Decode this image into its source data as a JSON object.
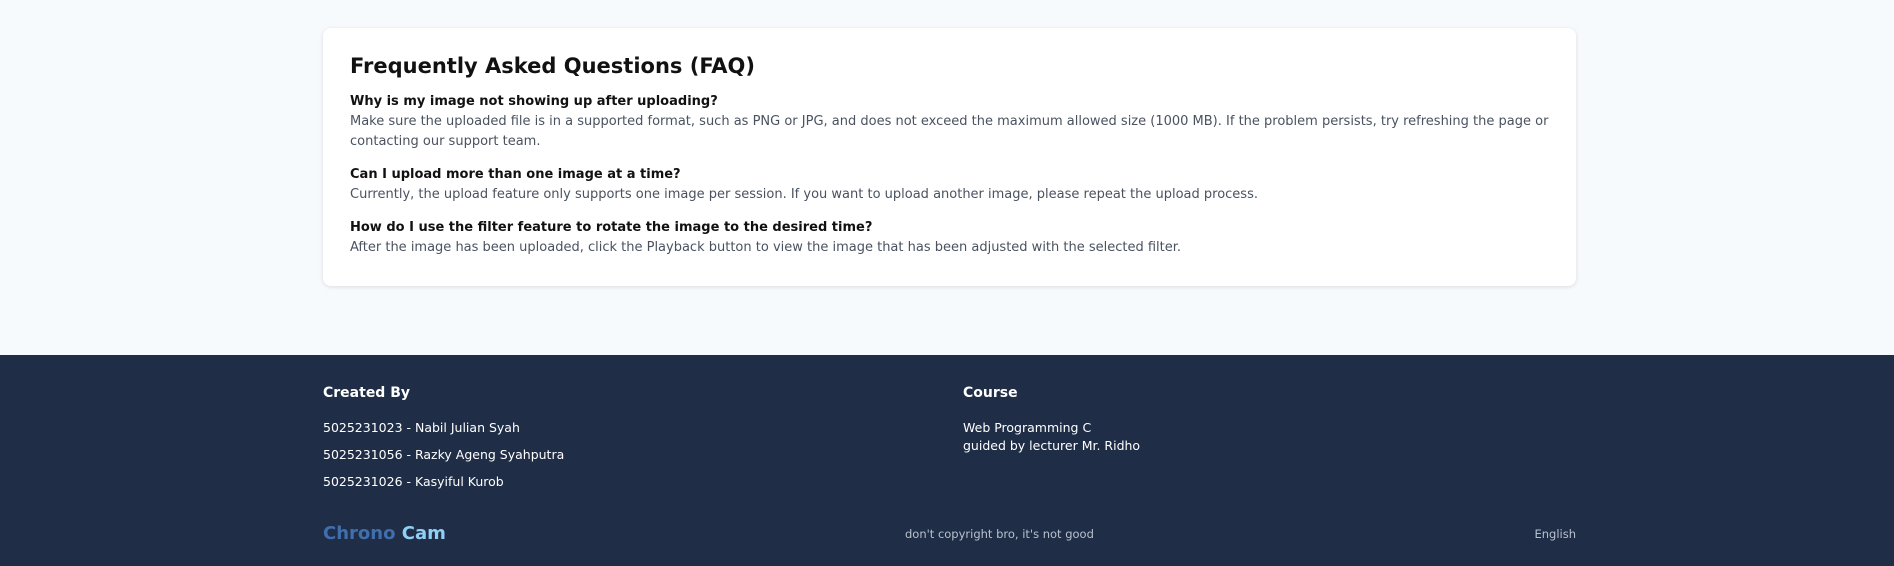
{
  "faq": {
    "title": "Frequently Asked Questions (FAQ)",
    "items": [
      {
        "question": "Why is my image not showing up after uploading?",
        "answer": "Make sure the uploaded file is in a supported format, such as PNG or JPG, and does not exceed the maximum allowed size (1000 MB). If the problem persists, try refreshing the page or contacting our support team."
      },
      {
        "question": "Can I upload more than one image at a time?",
        "answer": "Currently, the upload feature only supports one image per session. If you want to upload another image, please repeat the upload process."
      },
      {
        "question": "How do I use the filter feature to rotate the image to the desired time?",
        "answer": "After the image has been uploaded, click the Playback button to view the image that has been adjusted with the selected filter."
      }
    ]
  },
  "footer": {
    "created_by": {
      "title": "Created By",
      "members": [
        "5025231023 - Nabil Julian Syah",
        "5025231056 - Razky Ageng Syahputra",
        "5025231026 - Kasyiful Kurob"
      ]
    },
    "course": {
      "title": "Course",
      "line1": "Web Programming C",
      "line2": "guided by lecturer Mr. Ridho"
    },
    "brand": {
      "part1": "Chrono",
      "part2": "Cam",
      "color_part1": "#3f6fae",
      "color_part2": "#8fd0f5"
    },
    "tagline": "don't copyright bro, it's not good",
    "language": "English"
  },
  "colors": {
    "page_background": "#f7fafd",
    "footer_background": "#1f2d47",
    "card_background": "#ffffff"
  }
}
